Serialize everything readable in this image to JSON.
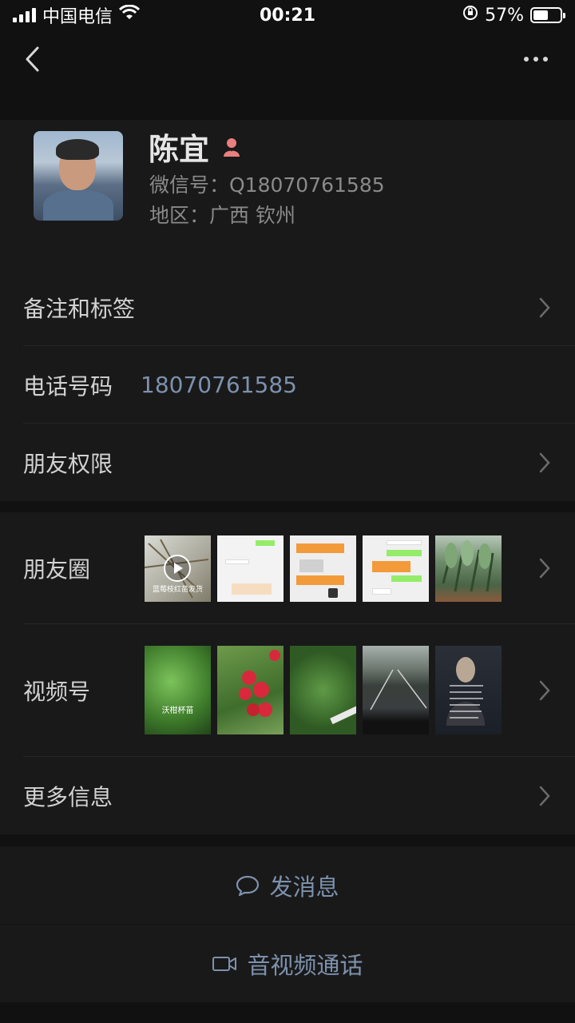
{
  "status_bar": {
    "carrier": "中国电信",
    "time": "00:21",
    "battery_percent_label": "57%",
    "battery_level": 0.57
  },
  "profile": {
    "name": "陈宜",
    "wechat_id": "微信号：Q18070761585",
    "region": "地区：广西 钦州",
    "gender": "female"
  },
  "rows": {
    "notes_tags": "备注和标签",
    "phone_label": "电话号码",
    "phone_value": "18070761585",
    "friend_permissions": "朋友权限",
    "moments": "朋友圈",
    "channels": "视频号",
    "more_info": "更多信息"
  },
  "moments_thumbs": {
    "first_caption": "蓝莓枝红苗发货"
  },
  "channels_thumbs": {
    "first_caption": "沃柑杯苗"
  },
  "actions": {
    "send_message": "发消息",
    "video_call": "音视频通话"
  },
  "colors": {
    "background": "#111111",
    "cell": "#191919",
    "link_blue": "#7d91ad",
    "gender_female": "#e9807f"
  }
}
